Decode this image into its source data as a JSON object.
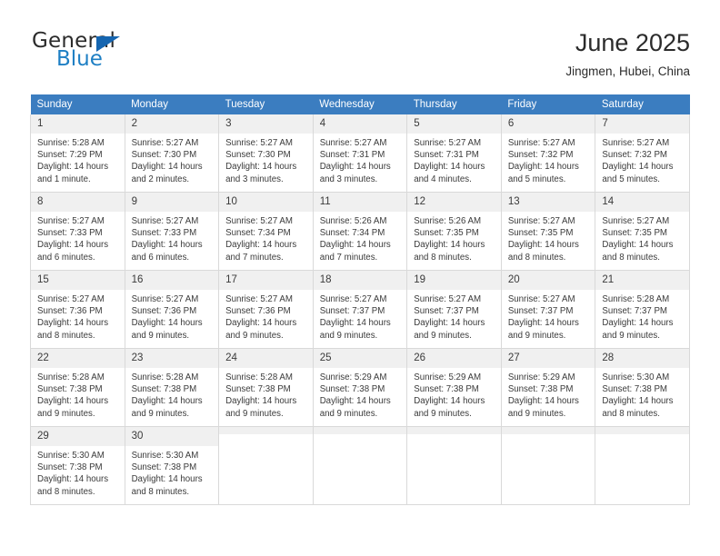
{
  "brand": {
    "name_part1": "General",
    "name_part2": "Blue",
    "triangle_color": "#1565b0",
    "blue_color": "#1e7fc4"
  },
  "header": {
    "title": "June 2025",
    "subtitle": "Jingmen, Hubei, China"
  },
  "theme": {
    "header_row_bg": "#3b7dc0",
    "header_row_text": "#ffffff",
    "daynum_bg": "#f0f0f0",
    "grid_line": "#d9d9d9"
  },
  "weekdays": [
    "Sunday",
    "Monday",
    "Tuesday",
    "Wednesday",
    "Thursday",
    "Friday",
    "Saturday"
  ],
  "labels": {
    "sunrise_prefix": "Sunrise:",
    "sunset_prefix": "Sunset:",
    "daylight_prefix": "Daylight:"
  },
  "weeks": [
    [
      {
        "day": "1",
        "sunrise": "Sunrise: 5:28 AM",
        "sunset": "Sunset: 7:29 PM",
        "daylight_line1": "Daylight: 14 hours",
        "daylight_line2": "and 1 minute."
      },
      {
        "day": "2",
        "sunrise": "Sunrise: 5:27 AM",
        "sunset": "Sunset: 7:30 PM",
        "daylight_line1": "Daylight: 14 hours",
        "daylight_line2": "and 2 minutes."
      },
      {
        "day": "3",
        "sunrise": "Sunrise: 5:27 AM",
        "sunset": "Sunset: 7:30 PM",
        "daylight_line1": "Daylight: 14 hours",
        "daylight_line2": "and 3 minutes."
      },
      {
        "day": "4",
        "sunrise": "Sunrise: 5:27 AM",
        "sunset": "Sunset: 7:31 PM",
        "daylight_line1": "Daylight: 14 hours",
        "daylight_line2": "and 3 minutes."
      },
      {
        "day": "5",
        "sunrise": "Sunrise: 5:27 AM",
        "sunset": "Sunset: 7:31 PM",
        "daylight_line1": "Daylight: 14 hours",
        "daylight_line2": "and 4 minutes."
      },
      {
        "day": "6",
        "sunrise": "Sunrise: 5:27 AM",
        "sunset": "Sunset: 7:32 PM",
        "daylight_line1": "Daylight: 14 hours",
        "daylight_line2": "and 5 minutes."
      },
      {
        "day": "7",
        "sunrise": "Sunrise: 5:27 AM",
        "sunset": "Sunset: 7:32 PM",
        "daylight_line1": "Daylight: 14 hours",
        "daylight_line2": "and 5 minutes."
      }
    ],
    [
      {
        "day": "8",
        "sunrise": "Sunrise: 5:27 AM",
        "sunset": "Sunset: 7:33 PM",
        "daylight_line1": "Daylight: 14 hours",
        "daylight_line2": "and 6 minutes."
      },
      {
        "day": "9",
        "sunrise": "Sunrise: 5:27 AM",
        "sunset": "Sunset: 7:33 PM",
        "daylight_line1": "Daylight: 14 hours",
        "daylight_line2": "and 6 minutes."
      },
      {
        "day": "10",
        "sunrise": "Sunrise: 5:27 AM",
        "sunset": "Sunset: 7:34 PM",
        "daylight_line1": "Daylight: 14 hours",
        "daylight_line2": "and 7 minutes."
      },
      {
        "day": "11",
        "sunrise": "Sunrise: 5:26 AM",
        "sunset": "Sunset: 7:34 PM",
        "daylight_line1": "Daylight: 14 hours",
        "daylight_line2": "and 7 minutes."
      },
      {
        "day": "12",
        "sunrise": "Sunrise: 5:26 AM",
        "sunset": "Sunset: 7:35 PM",
        "daylight_line1": "Daylight: 14 hours",
        "daylight_line2": "and 8 minutes."
      },
      {
        "day": "13",
        "sunrise": "Sunrise: 5:27 AM",
        "sunset": "Sunset: 7:35 PM",
        "daylight_line1": "Daylight: 14 hours",
        "daylight_line2": "and 8 minutes."
      },
      {
        "day": "14",
        "sunrise": "Sunrise: 5:27 AM",
        "sunset": "Sunset: 7:35 PM",
        "daylight_line1": "Daylight: 14 hours",
        "daylight_line2": "and 8 minutes."
      }
    ],
    [
      {
        "day": "15",
        "sunrise": "Sunrise: 5:27 AM",
        "sunset": "Sunset: 7:36 PM",
        "daylight_line1": "Daylight: 14 hours",
        "daylight_line2": "and 8 minutes."
      },
      {
        "day": "16",
        "sunrise": "Sunrise: 5:27 AM",
        "sunset": "Sunset: 7:36 PM",
        "daylight_line1": "Daylight: 14 hours",
        "daylight_line2": "and 9 minutes."
      },
      {
        "day": "17",
        "sunrise": "Sunrise: 5:27 AM",
        "sunset": "Sunset: 7:36 PM",
        "daylight_line1": "Daylight: 14 hours",
        "daylight_line2": "and 9 minutes."
      },
      {
        "day": "18",
        "sunrise": "Sunrise: 5:27 AM",
        "sunset": "Sunset: 7:37 PM",
        "daylight_line1": "Daylight: 14 hours",
        "daylight_line2": "and 9 minutes."
      },
      {
        "day": "19",
        "sunrise": "Sunrise: 5:27 AM",
        "sunset": "Sunset: 7:37 PM",
        "daylight_line1": "Daylight: 14 hours",
        "daylight_line2": "and 9 minutes."
      },
      {
        "day": "20",
        "sunrise": "Sunrise: 5:27 AM",
        "sunset": "Sunset: 7:37 PM",
        "daylight_line1": "Daylight: 14 hours",
        "daylight_line2": "and 9 minutes."
      },
      {
        "day": "21",
        "sunrise": "Sunrise: 5:28 AM",
        "sunset": "Sunset: 7:37 PM",
        "daylight_line1": "Daylight: 14 hours",
        "daylight_line2": "and 9 minutes."
      }
    ],
    [
      {
        "day": "22",
        "sunrise": "Sunrise: 5:28 AM",
        "sunset": "Sunset: 7:38 PM",
        "daylight_line1": "Daylight: 14 hours",
        "daylight_line2": "and 9 minutes."
      },
      {
        "day": "23",
        "sunrise": "Sunrise: 5:28 AM",
        "sunset": "Sunset: 7:38 PM",
        "daylight_line1": "Daylight: 14 hours",
        "daylight_line2": "and 9 minutes."
      },
      {
        "day": "24",
        "sunrise": "Sunrise: 5:28 AM",
        "sunset": "Sunset: 7:38 PM",
        "daylight_line1": "Daylight: 14 hours",
        "daylight_line2": "and 9 minutes."
      },
      {
        "day": "25",
        "sunrise": "Sunrise: 5:29 AM",
        "sunset": "Sunset: 7:38 PM",
        "daylight_line1": "Daylight: 14 hours",
        "daylight_line2": "and 9 minutes."
      },
      {
        "day": "26",
        "sunrise": "Sunrise: 5:29 AM",
        "sunset": "Sunset: 7:38 PM",
        "daylight_line1": "Daylight: 14 hours",
        "daylight_line2": "and 9 minutes."
      },
      {
        "day": "27",
        "sunrise": "Sunrise: 5:29 AM",
        "sunset": "Sunset: 7:38 PM",
        "daylight_line1": "Daylight: 14 hours",
        "daylight_line2": "and 9 minutes."
      },
      {
        "day": "28",
        "sunrise": "Sunrise: 5:30 AM",
        "sunset": "Sunset: 7:38 PM",
        "daylight_line1": "Daylight: 14 hours",
        "daylight_line2": "and 8 minutes."
      }
    ],
    [
      {
        "day": "29",
        "sunrise": "Sunrise: 5:30 AM",
        "sunset": "Sunset: 7:38 PM",
        "daylight_line1": "Daylight: 14 hours",
        "daylight_line2": "and 8 minutes."
      },
      {
        "day": "30",
        "sunrise": "Sunrise: 5:30 AM",
        "sunset": "Sunset: 7:38 PM",
        "daylight_line1": "Daylight: 14 hours",
        "daylight_line2": "and 8 minutes."
      },
      {
        "day": "",
        "sunrise": "",
        "sunset": "",
        "daylight_line1": "",
        "daylight_line2": ""
      },
      {
        "day": "",
        "sunrise": "",
        "sunset": "",
        "daylight_line1": "",
        "daylight_line2": ""
      },
      {
        "day": "",
        "sunrise": "",
        "sunset": "",
        "daylight_line1": "",
        "daylight_line2": ""
      },
      {
        "day": "",
        "sunrise": "",
        "sunset": "",
        "daylight_line1": "",
        "daylight_line2": ""
      },
      {
        "day": "",
        "sunrise": "",
        "sunset": "",
        "daylight_line1": "",
        "daylight_line2": ""
      }
    ]
  ]
}
